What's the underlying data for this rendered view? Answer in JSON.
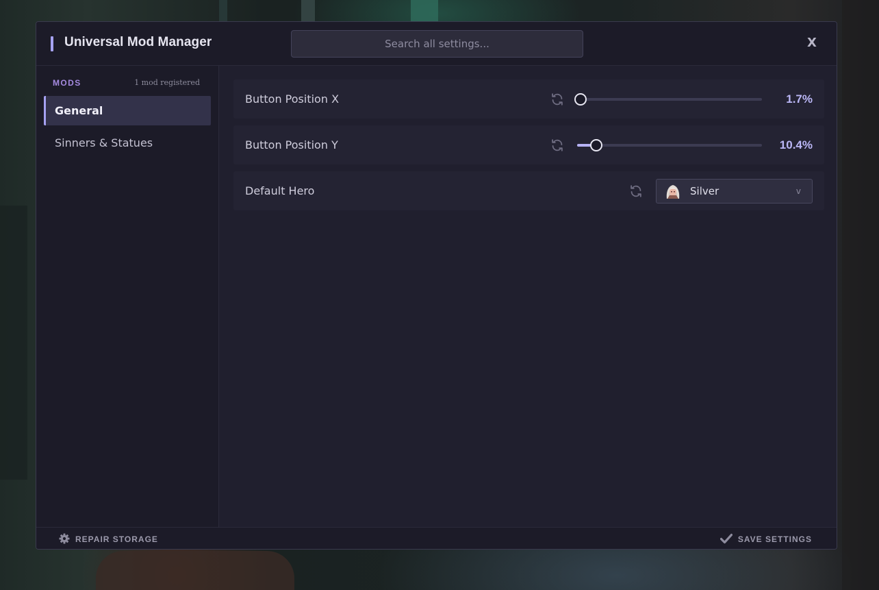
{
  "window": {
    "title": "Universal Mod Manager",
    "close_label": "X"
  },
  "search": {
    "placeholder": "Search all settings..."
  },
  "sidebar": {
    "header": "MODS",
    "count": "1 mod registered",
    "items": [
      {
        "label": "General",
        "active": true
      },
      {
        "label": "Sinners & Statues",
        "active": false
      }
    ]
  },
  "settings": [
    {
      "label": "Button Position X",
      "type": "slider",
      "value_text": "1.7%",
      "value": 1.7
    },
    {
      "label": "Button Position Y",
      "type": "slider",
      "value_text": "10.4%",
      "value": 10.4
    },
    {
      "label": "Default Hero",
      "type": "select",
      "selected": "Silver",
      "chevron": "v"
    }
  ],
  "footer": {
    "repair_label": "REPAIR STORAGE",
    "save_label": "SAVE SETTINGS"
  },
  "icons": {
    "reset": "refresh-icon",
    "repair": "gear-icon",
    "save": "check-icon",
    "hero": "hero-avatar-icon"
  },
  "colors": {
    "accent": "#a6a2f2",
    "mods_header": "#a58ae0",
    "value_text": "#bbb7f6"
  }
}
